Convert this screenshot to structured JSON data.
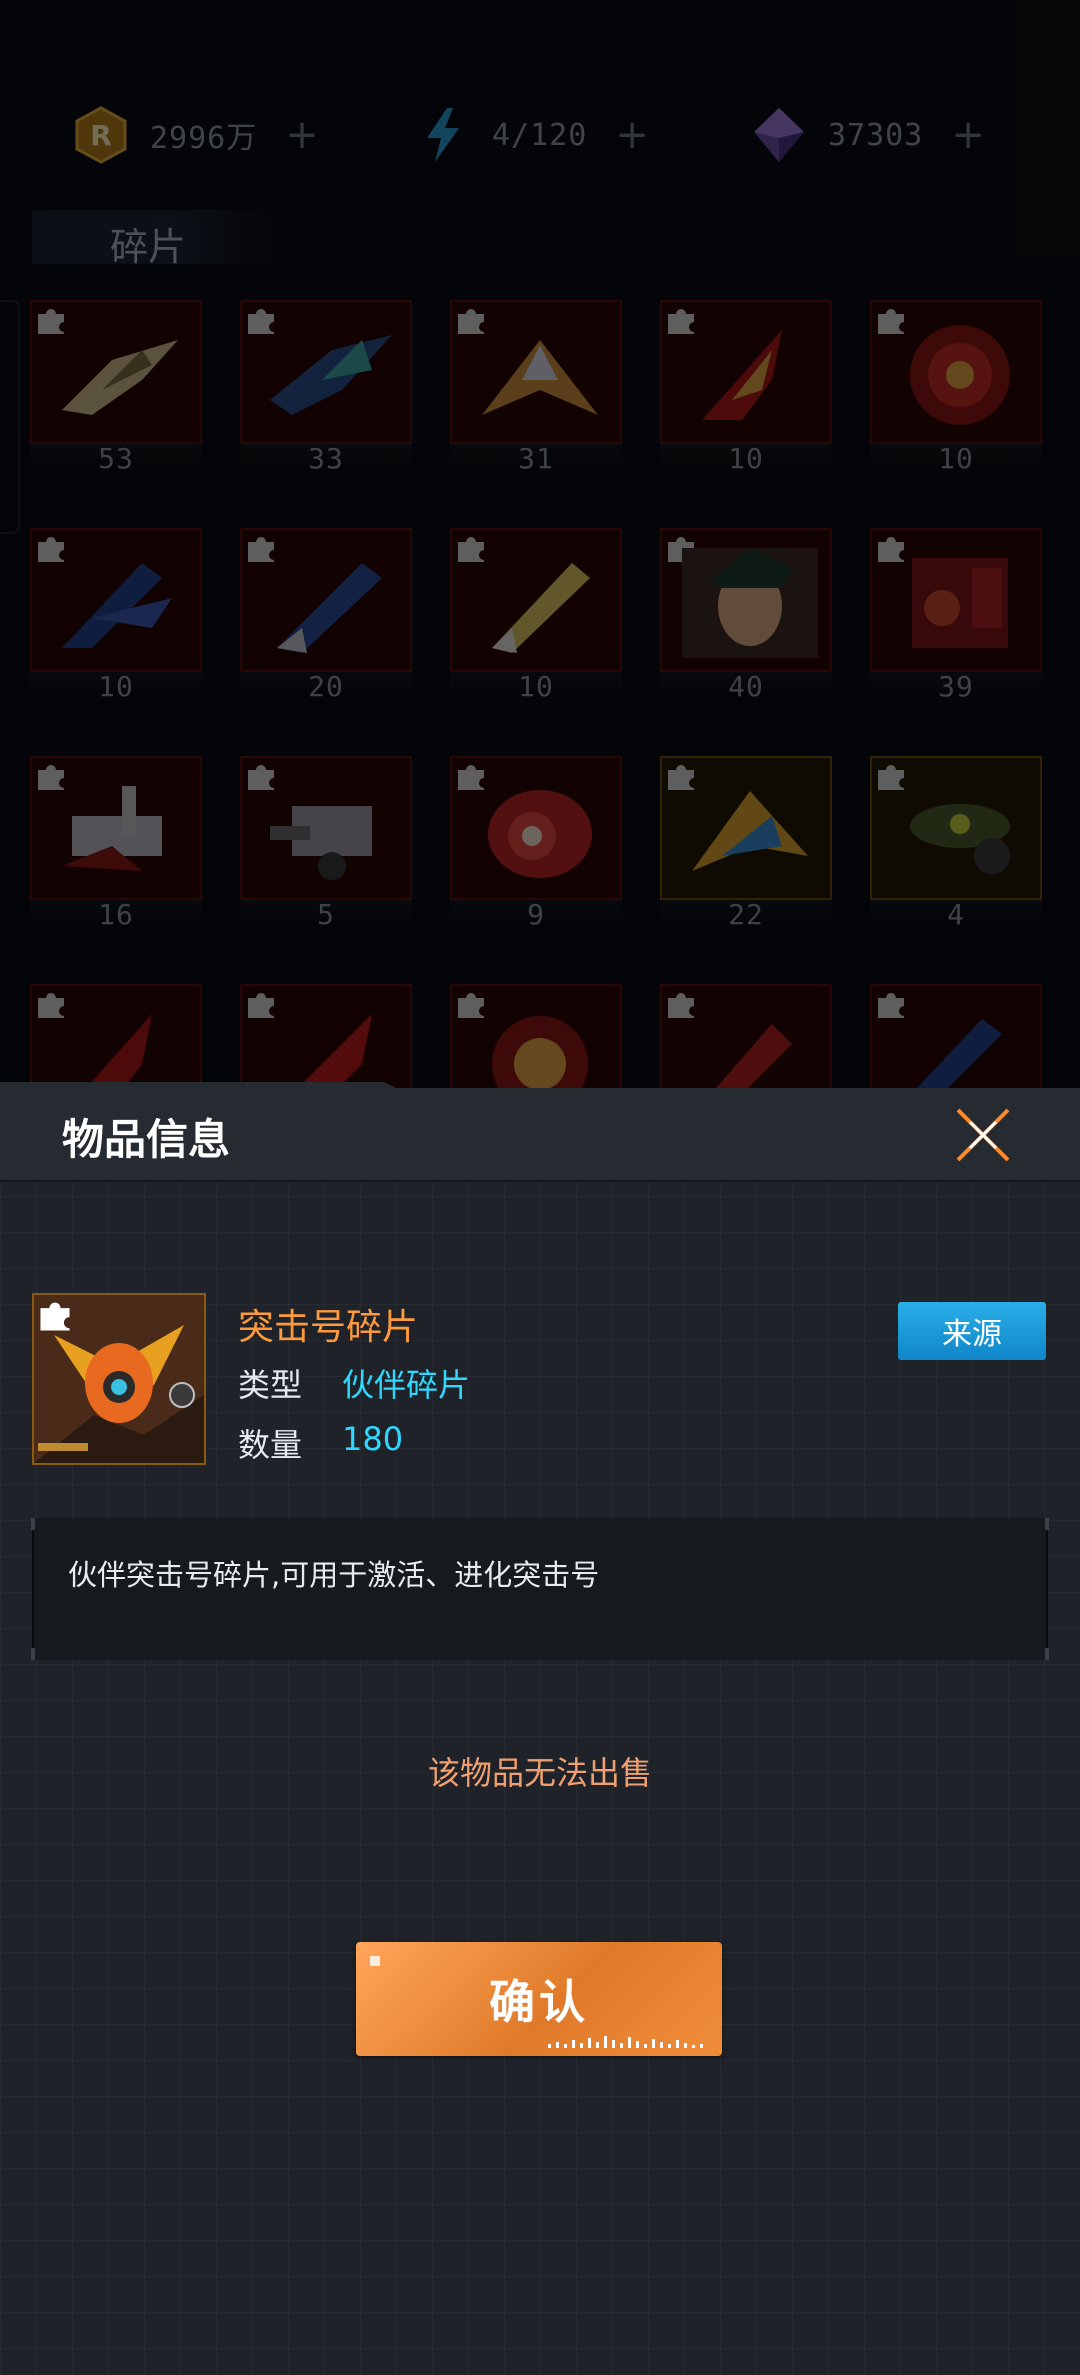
{
  "currencies": [
    {
      "icon": "gold-coin-icon",
      "value": "2996万",
      "plus": "+"
    },
    {
      "icon": "energy-bolt-icon",
      "value": "4/120",
      "plus": "+"
    },
    {
      "icon": "diamond-gem-icon",
      "value": "37303",
      "plus": "+"
    }
  ],
  "section_title": "碎片",
  "inventory_counts": [
    "53",
    "33",
    "31",
    "10",
    "10",
    "10",
    "20",
    "10",
    "40",
    "39",
    "16",
    "5",
    "9",
    "22",
    "4"
  ],
  "modal": {
    "title": "物品信息",
    "item_name": "突击号碎片",
    "type_label": "类型",
    "type_value": "伙伴碎片",
    "quantity_label": "数量",
    "quantity_value": "180",
    "source_button": "来源",
    "description": "伙伴突击号碎片,可用于激活、进化突击号",
    "sell_notice": "该物品无法出售",
    "confirm_button": "确认"
  },
  "colors": {
    "accent_orange": "#ff9a3c",
    "value_cyan": "#2ed8ff",
    "button_blue": "#1a9ad8",
    "notice": "#f0a070"
  }
}
